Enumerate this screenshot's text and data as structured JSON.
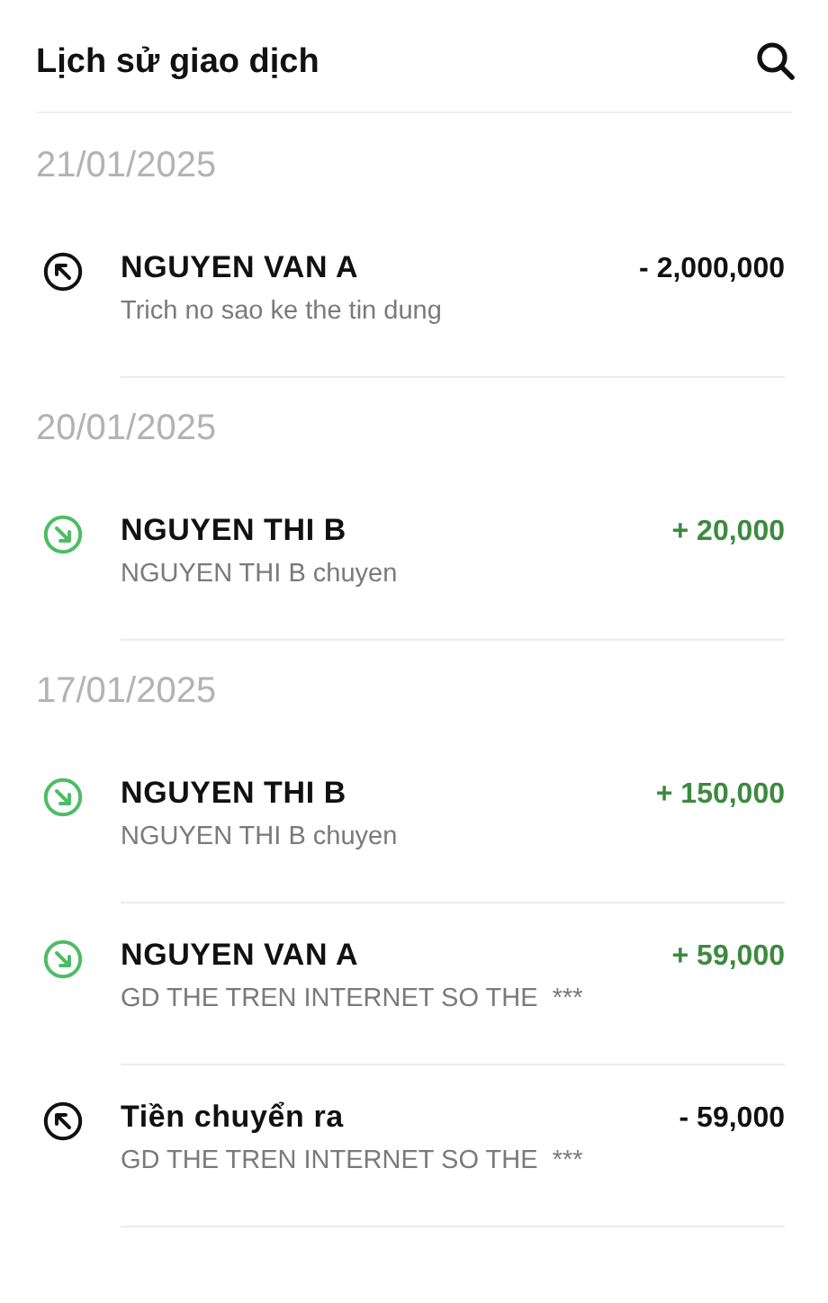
{
  "header": {
    "title": "Lịch sử giao dịch"
  },
  "groups": [
    {
      "date": "21/01/2025",
      "transactions": [
        {
          "kind": "out",
          "name": "NGUYEN VAN A",
          "description": "Trich no sao ke the tin dung",
          "amount": "- 2,000,000"
        }
      ]
    },
    {
      "date": "20/01/2025",
      "transactions": [
        {
          "kind": "in",
          "name": "NGUYEN THI B",
          "description": "NGUYEN THI B chuyen",
          "amount": "+ 20,000"
        }
      ]
    },
    {
      "date": "17/01/2025",
      "transactions": [
        {
          "kind": "in",
          "name": "NGUYEN THI B",
          "description": "NGUYEN THI B chuyen",
          "amount": "+ 150,000"
        },
        {
          "kind": "in",
          "name": "NGUYEN VAN A",
          "description": "GD THE TREN INTERNET SO THE  ***",
          "amount": "+ 59,000"
        },
        {
          "kind": "out",
          "name": "Tiền chuyển ra",
          "description": "GD THE TREN INTERNET SO THE  ***",
          "amount": "- 59,000"
        }
      ]
    }
  ]
}
